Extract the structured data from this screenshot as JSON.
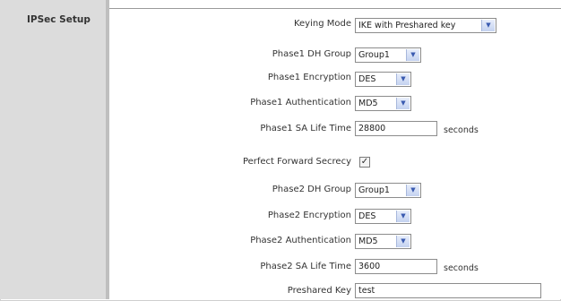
{
  "section": {
    "title": "IPSec Setup"
  },
  "form": {
    "keying_mode": {
      "label": "Keying Mode",
      "value": "IKE with Preshared key"
    },
    "phase1_dh_group": {
      "label": "Phase1 DH Group",
      "value": "Group1"
    },
    "phase1_encryption": {
      "label": "Phase1 Encryption",
      "value": "DES"
    },
    "phase1_authentication": {
      "label": "Phase1 Authentication",
      "value": "MD5"
    },
    "phase1_sa_lifetime": {
      "label": "Phase1 SA Life Time",
      "value": "28800",
      "unit": "seconds"
    },
    "pfs": {
      "label": "Perfect Forward Secrecy",
      "checked": true
    },
    "phase2_dh_group": {
      "label": "Phase2 DH Group",
      "value": "Group1"
    },
    "phase2_encryption": {
      "label": "Phase2 Encryption",
      "value": "DES"
    },
    "phase2_authentication": {
      "label": "Phase2 Authentication",
      "value": "MD5"
    },
    "phase2_sa_lifetime": {
      "label": "Phase2 SA Life Time",
      "value": "3600",
      "unit": "seconds"
    },
    "preshared_key": {
      "label": "Preshared Key",
      "value": "test"
    }
  }
}
